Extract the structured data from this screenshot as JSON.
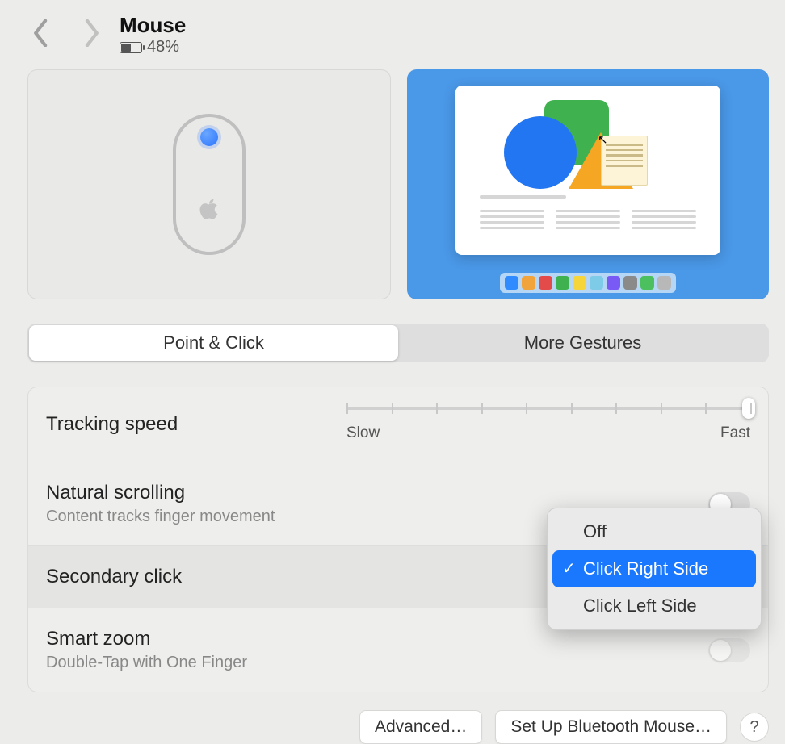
{
  "header": {
    "title": "Mouse",
    "battery_text": "48%"
  },
  "tabs": {
    "point_click": "Point & Click",
    "more_gestures": "More Gestures"
  },
  "settings": {
    "tracking": {
      "label": "Tracking speed",
      "min_label": "Slow",
      "max_label": "Fast"
    },
    "natural_scrolling": {
      "label": "Natural scrolling",
      "sub": "Content tracks finger movement"
    },
    "secondary_click": {
      "label": "Secondary click",
      "options": {
        "off": "Off",
        "right": "Click Right Side",
        "left": "Click Left Side"
      }
    },
    "smart_zoom": {
      "label": "Smart zoom",
      "sub": "Double-Tap with One Finger"
    }
  },
  "footer": {
    "advanced": "Advanced…",
    "setup_bt": "Set Up Bluetooth Mouse…",
    "help": "?"
  },
  "dock_colors": [
    "#2f8bff",
    "#f2a43c",
    "#e34b4b",
    "#3fb24f",
    "#f5d53a",
    "#7ecbe8",
    "#7a5af5",
    "#8a8a8a",
    "#4cbf5e",
    "#b8b8b8"
  ]
}
